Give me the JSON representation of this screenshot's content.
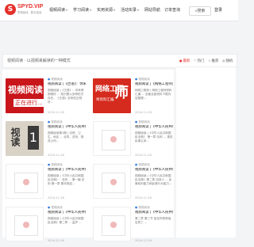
{
  "header": {
    "logo_mark": "S",
    "logo_text": "SPYD.VIP",
    "logo_sub": "思博阅读 · 数字阅读",
    "nav": [
      {
        "label": "视频阅读",
        "caret": "▾"
      },
      {
        "label": "学习阅读",
        "caret": "▾"
      },
      {
        "label": "实用资源",
        "caret": "▾"
      },
      {
        "label": "活动实录",
        "caret": "▾"
      },
      {
        "label": "网站导航",
        "caret": ""
      },
      {
        "label": "订单查询",
        "caret": ""
      }
    ],
    "search_label": "搜索",
    "login_label": "登录"
  },
  "breadcrumb": "视频阅读 · 以视频来解读的一种模式",
  "sidebar": {
    "tabs": [
      {
        "icon": "●",
        "label": "最新"
      },
      {
        "icon": "♡",
        "label": "热门"
      },
      {
        "icon": "☆",
        "label": "推荐"
      },
      {
        "icon": "◎",
        "label": "随机"
      }
    ]
  },
  "cards": [
    {
      "thumb": {
        "style": "red",
        "big": "视频阅读",
        "small": "正在进行..."
      },
      "category": "视频阅读",
      "title": "视频阅读 |《古语》：你来得刚刚好",
      "desc": "视频阅读 |《古语》：你来得刚刚好 ... 知识是以多种形式存在，《古语》说来的正刚好...",
      "foot": "2024-11-26"
    },
    {
      "thumb": {
        "style": "eng",
        "big": "网络工程",
        "small": "师资料汇编",
        "shi": "师"
      },
      "category": "视频阅读",
      "title": "视频阅读 |《网络工程师》资料汇编",
      "desc": "网络工程师 | 网络工程师资料汇编 ... 全套全部资料下载内容整理...",
      "foot": "2024-11-26"
    },
    {
      "thumb": {
        "style": "read",
        "big": "视读",
        "num": "1"
      },
      "category": "视频阅读",
      "title": "视频阅读 |《中华人民共和国民法典》",
      "desc": "视频阅读第1期 | 法院、卫生、地区 ... 合同、总则、规范公司...",
      "foot": "2024-11-26"
    },
    {
      "thumb": {
        "style": "blank"
      },
      "category": "视频阅读",
      "title": "视频阅读 |《中华人民共和国民法典》",
      "desc": "视频阅读 |《中华人民共和国民法典》 第一章 总则 ... 规范民事主体...",
      "foot": "2024-11-26"
    },
    {
      "thumb": {
        "style": "blank"
      },
      "category": "视频阅读",
      "title": "视频阅读 |《中华人民共和国民法典》：总则",
      "desc": "视频阅读 |《中华人民共和国民法典》：总则 ... 第一编 总则 第一章 基本规定...",
      "foot": "2024-11-26"
    },
    {
      "thumb": {
        "style": "blank"
      },
      "category": "视频阅读",
      "title": "视频阅读 |《中华人民共和国民法典》第二章",
      "desc": "视频阅读 |《中华人民共和国民法典》第二章 自然人 ... 民事权利能力和民事行为能力...",
      "foot": "2024-11-26"
    },
    {
      "thumb": {
        "style": "blank"
      },
      "category": "视频阅读",
      "title": "视频阅读 |《中华人民共和国民法典》第二章",
      "desc": "视频阅读 |《中华人民共和国民法典》第二章 ... 监护 ...",
      "foot": "2024-11-26"
    },
    {
      "thumb": {
        "style": "blank"
      },
      "category": "视频阅读",
      "title": "视频阅读 |《中华人民共和国民法典》第二章 第三节",
      "desc": "第二章 第三节 宣告失踪和宣告死亡 ...",
      "foot": "2024-11-26"
    }
  ]
}
